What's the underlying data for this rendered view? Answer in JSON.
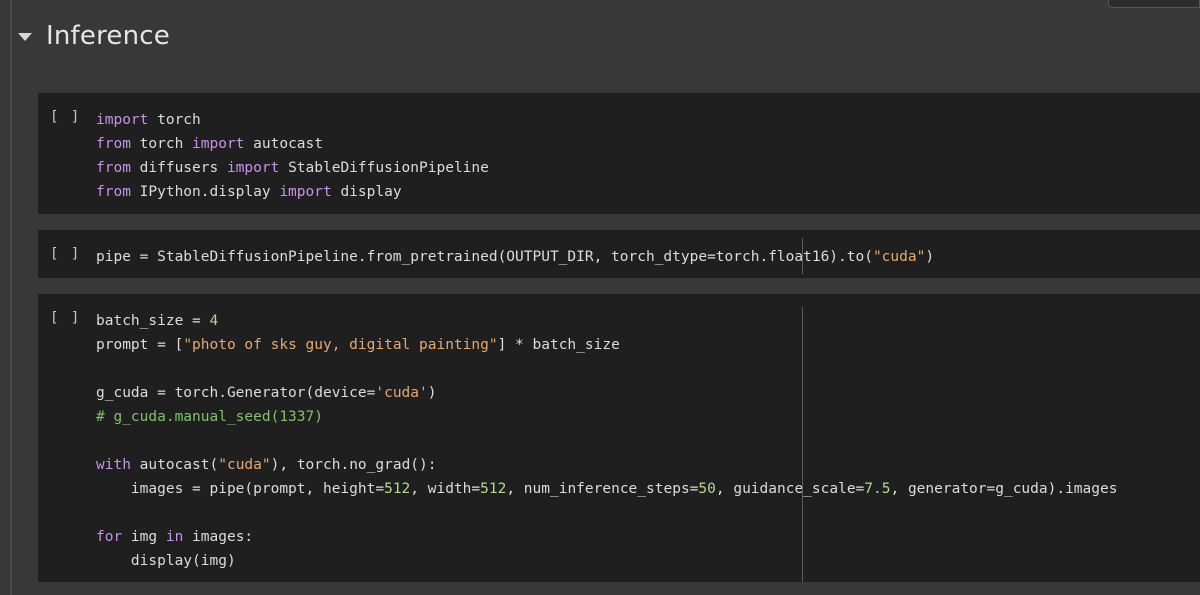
{
  "section": {
    "title": "Inference"
  },
  "cells": [
    {
      "run_label": "[ ]",
      "lines": [
        [
          [
            "kw",
            "import"
          ],
          [
            "t",
            " torch"
          ]
        ],
        [
          [
            "kw",
            "from"
          ],
          [
            "t",
            " torch "
          ],
          [
            "kw",
            "import"
          ],
          [
            "t",
            " autocast"
          ]
        ],
        [
          [
            "kw",
            "from"
          ],
          [
            "t",
            " diffusers "
          ],
          [
            "kw",
            "import"
          ],
          [
            "t",
            " StableDiffusionPipeline"
          ]
        ],
        [
          [
            "kw",
            "from"
          ],
          [
            "t",
            " IPython.display "
          ],
          [
            "kw",
            "import"
          ],
          [
            "t",
            " display"
          ]
        ]
      ]
    },
    {
      "run_label": "[ ]",
      "lines": [
        [
          [
            "t",
            "pipe = StableDiffusionPipeline.from_pretrained(OUTPUT_DIR, torch_dtype=torch.float16).to("
          ],
          [
            "str",
            "\"cuda\""
          ],
          [
            "t",
            ")"
          ]
        ]
      ]
    },
    {
      "run_label": "[ ]",
      "lines": [
        [
          [
            "t",
            "batch_size = "
          ],
          [
            "num",
            "4"
          ]
        ],
        [
          [
            "t",
            "prompt = ["
          ],
          [
            "str",
            "\"photo of sks guy, digital painting\""
          ],
          [
            "t",
            "] * batch_size"
          ]
        ],
        [],
        [
          [
            "t",
            "g_cuda = torch.Generator(device="
          ],
          [
            "str",
            "'cuda'"
          ],
          [
            "t",
            ")"
          ]
        ],
        [
          [
            "cmt",
            "# g_cuda.manual_seed(1337)"
          ]
        ],
        [],
        [
          [
            "kw",
            "with"
          ],
          [
            "t",
            " autocast("
          ],
          [
            "str",
            "\"cuda\""
          ],
          [
            "t",
            "), torch.no_grad():"
          ]
        ],
        [
          [
            "t",
            "    images = pipe(prompt, height="
          ],
          [
            "num",
            "512"
          ],
          [
            "t",
            ", width="
          ],
          [
            "num",
            "512"
          ],
          [
            "t",
            ", num_inference_steps="
          ],
          [
            "num",
            "50"
          ],
          [
            "t",
            ", guidance_scale="
          ],
          [
            "num",
            "7.5"
          ],
          [
            "t",
            ", generator=g_cuda).images"
          ]
        ],
        [],
        [
          [
            "kw",
            "for"
          ],
          [
            "t",
            " img "
          ],
          [
            "kw",
            "in"
          ],
          [
            "t",
            " images:"
          ]
        ],
        [
          [
            "t",
            "    display(img)"
          ]
        ]
      ]
    }
  ]
}
